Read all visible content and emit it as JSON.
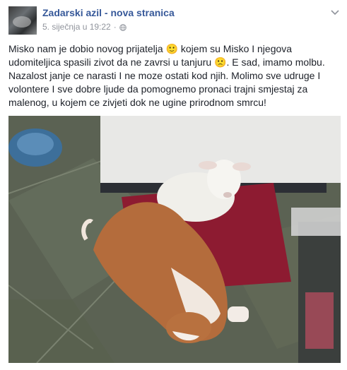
{
  "post": {
    "page_name": "Zadarski azil - nova stranica",
    "timestamp": "5. siječnja u 19:22",
    "separator": "·",
    "privacy_icon": "globe-icon",
    "options_icon": "chevron-down-icon",
    "text": "Misko nam je dobio novog prijatelja 🙂 kojem su Misko I njegova udomiteljica spasili zivot da ne zavrsi u tanjuru 🙁. E sad, imamo molbu. Nazalost janje ce narasti I ne moze ostati kod njih. Molimo sve udruge I volontere I sve dobre ljude da pomognemo pronaci trajni smjestaj za malenog, u kojem ce zivjeti dok ne ugine prirodnom smrcu!"
  },
  "photo": {
    "subject": "dog and lamb lying on red mat"
  },
  "colors": {
    "link": "#365899",
    "meta": "#90949c",
    "text": "#1d2129"
  }
}
